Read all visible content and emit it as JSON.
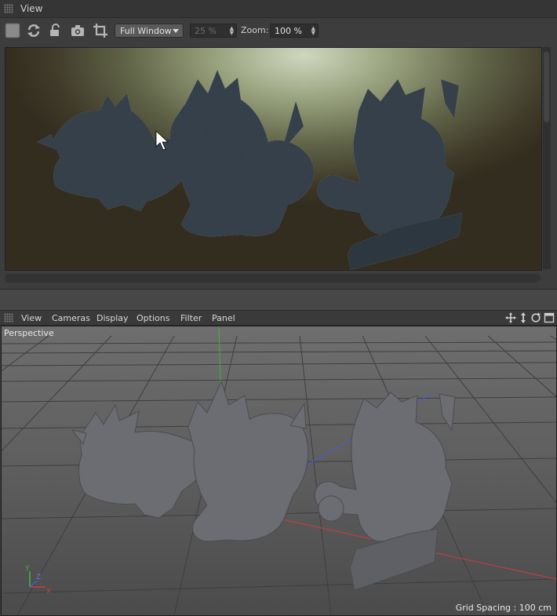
{
  "render_view": {
    "title": "View",
    "toolbar": {
      "region_select": "Full Window",
      "percent_value": "25 %",
      "zoom_label": "Zoom:",
      "zoom_value": "100 %"
    }
  },
  "viewport": {
    "menu": [
      "View",
      "Cameras",
      "Display",
      "Options",
      "Filter",
      "Panel"
    ],
    "camera_label": "Perspective",
    "grid_spacing": "Grid Spacing : 100 cm"
  },
  "icons": {
    "toolbar": [
      "stop-render-icon",
      "refresh-icon",
      "lock-icon",
      "camera-icon",
      "crop-icon"
    ],
    "viewport_nav": [
      "move-icon",
      "zoom-icon",
      "rotate-icon",
      "maximize-icon"
    ],
    "axis_colors": {
      "x": "#d03c3c",
      "y": "#3ab83a",
      "z": "#4a5ad8"
    }
  }
}
